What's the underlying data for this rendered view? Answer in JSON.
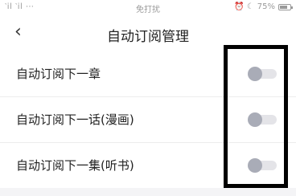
{
  "status_bar": {
    "signal": "‵il ‵il ⋯",
    "center": "免打扰",
    "icons": "⏰ ☾",
    "battery": "75%"
  },
  "nav": {
    "back_icon": "‹",
    "title": "自动订阅管理"
  },
  "settings": [
    {
      "label": "自动订阅下一章",
      "enabled": false
    },
    {
      "label": "自动订阅下一话(漫画)",
      "enabled": false
    },
    {
      "label": "自动订阅下一集(听书)",
      "enabled": false
    }
  ],
  "colors": {
    "toggle_off_knob": "#a9acb7",
    "toggle_off_track": "#e4e4e8",
    "highlight_border": "#000000"
  }
}
